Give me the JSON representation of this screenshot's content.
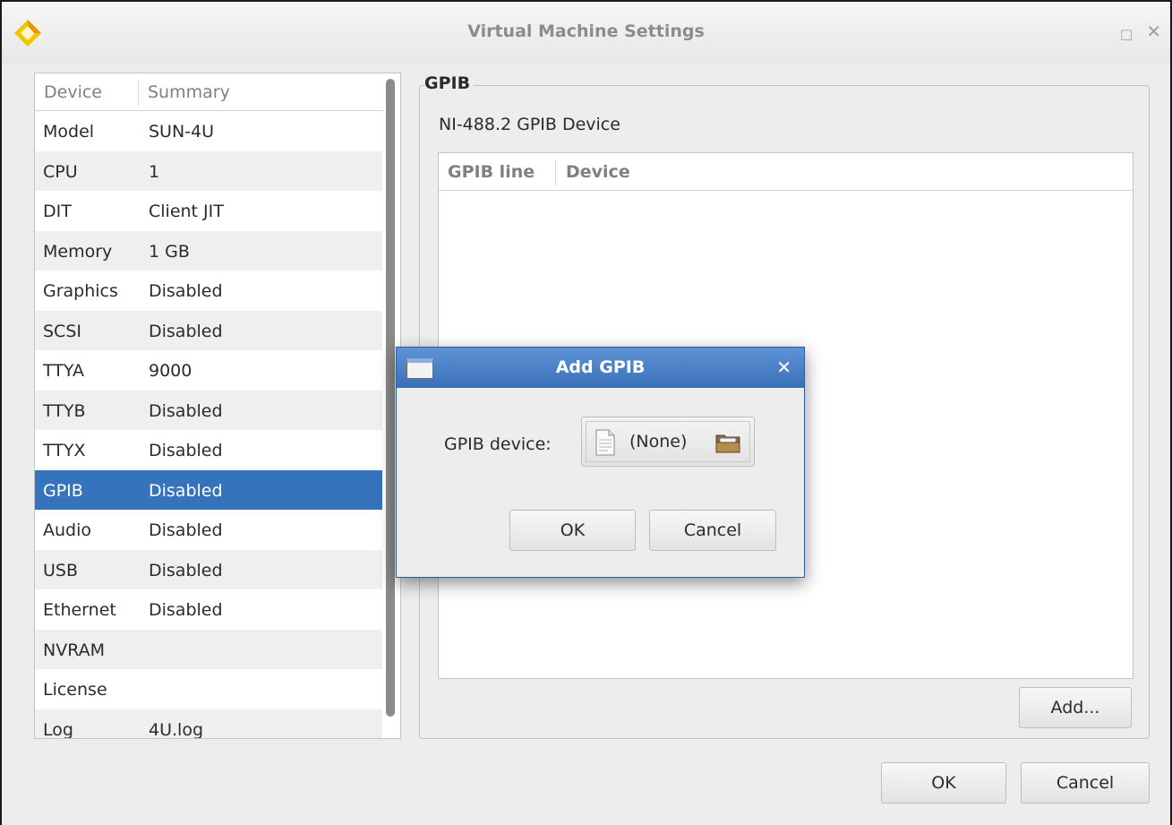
{
  "window": {
    "title": "Virtual Machine Settings",
    "max_glyph": "□",
    "close_glyph": "✕"
  },
  "device_list": {
    "headers": [
      "Device",
      "Summary"
    ],
    "rows": [
      {
        "device": "Model",
        "summary": "SUN-4U"
      },
      {
        "device": "CPU",
        "summary": "1"
      },
      {
        "device": "DIT",
        "summary": "Client JIT"
      },
      {
        "device": "Memory",
        "summary": "1 GB"
      },
      {
        "device": "Graphics",
        "summary": "Disabled"
      },
      {
        "device": "SCSI",
        "summary": "Disabled"
      },
      {
        "device": "TTYA",
        "summary": "9000"
      },
      {
        "device": "TTYB",
        "summary": "Disabled"
      },
      {
        "device": "TTYX",
        "summary": "Disabled"
      },
      {
        "device": "GPIB",
        "summary": "Disabled"
      },
      {
        "device": "Audio",
        "summary": "Disabled"
      },
      {
        "device": "USB",
        "summary": "Disabled"
      },
      {
        "device": "Ethernet",
        "summary": "Disabled"
      },
      {
        "device": "NVRAM",
        "summary": ""
      },
      {
        "device": "License",
        "summary": ""
      },
      {
        "device": "Log",
        "summary": "4U.log"
      }
    ],
    "selected": "GPIB"
  },
  "gpib_panel": {
    "title": "GPIB",
    "subtitle": "NI-488.2 GPIB Device",
    "table_headers": [
      "GPIB line",
      "Device"
    ],
    "add_label": "Add..."
  },
  "footer": {
    "ok_label": "OK",
    "cancel_label": "Cancel"
  },
  "dialog": {
    "title": "Add GPIB",
    "close_glyph": "✕",
    "field_label": "GPIB device:",
    "field_value": "(None)",
    "ok_label": "OK",
    "cancel_label": "Cancel"
  },
  "colors": {
    "selection": "#3574bd",
    "dialog_title": "#3a70b8",
    "logo": "#f5c400"
  },
  "icons": [
    "app-logo-icon",
    "maximize-icon",
    "close-icon",
    "window-icon",
    "document-icon",
    "folder-icon"
  ]
}
